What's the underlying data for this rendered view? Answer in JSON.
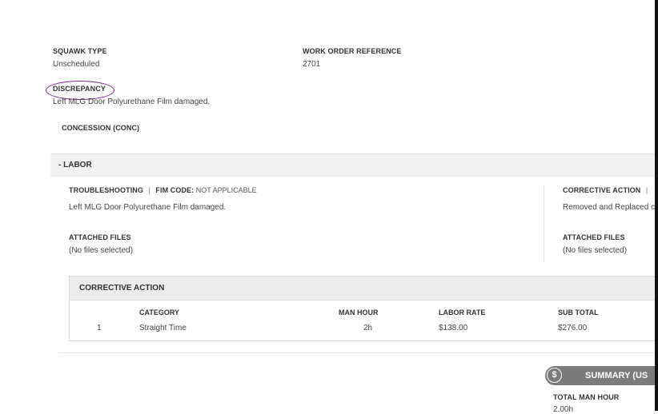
{
  "header": {
    "squawk_type_label": "SQUAWK TYPE",
    "squawk_type_value": "Unscheduled",
    "work_order_label": "WORK ORDER REFERENCE",
    "work_order_value": "2701",
    "discrepancy_label": "DISCREPANCY",
    "discrepancy_value": "Left MLG Door Polyurethane Film damaged.",
    "concession_label": "CONCESSION (CONC)"
  },
  "labor": {
    "title": "- LABOR",
    "troubleshooting": {
      "label": "TROUBLESHOOTING",
      "sep": "|",
      "fim_label": "FIM CODE:",
      "fim_value": "NOT APPLICABLE",
      "text": "Left MLG Door Polyurethane Film damaged.",
      "attached_label": "ATTACHED FILES",
      "attached_value": "(No files selected)"
    },
    "corrective": {
      "label": "CORRECTIVE ACTION",
      "sep": "|",
      "text": "Removed and Replaced c",
      "attached_label": "ATTACHED FILES",
      "attached_value": "(No files selected)"
    }
  },
  "corrective_table": {
    "title": "CORRECTIVE ACTION",
    "columns": [
      "CATEGORY",
      "MAN HOUR",
      "LABOR RATE",
      "SUB TOTAL"
    ],
    "rows": [
      {
        "index": "1",
        "category": "Straight Time",
        "man_hour": "2h",
        "labor_rate": "$138.00",
        "sub_total": "$276.00"
      }
    ]
  },
  "summary": {
    "icon": "dollar-icon",
    "icon_glyph": "$",
    "title": "SUMMARY (US",
    "total_man_hour_label": "TOTAL MAN HOUR",
    "total_man_hour_value": "2.00h"
  },
  "colors": {
    "annotation_circle": "#7a2a8a",
    "summary_bg": "#7b7b7b"
  }
}
